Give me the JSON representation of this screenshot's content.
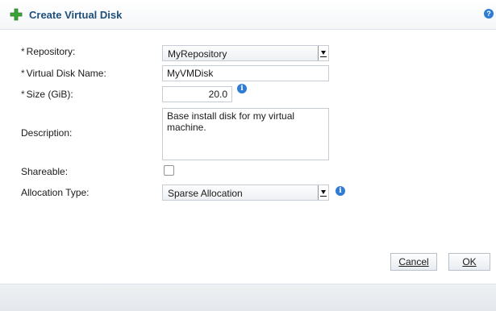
{
  "dialog": {
    "title": "Create Virtual Disk",
    "help_icon": "question-icon",
    "title_icon": "plus-icon"
  },
  "form": {
    "repository": {
      "required_mark": "*",
      "label": "Repository:",
      "value": "MyRepository"
    },
    "disk_name": {
      "required_mark": "*",
      "label": "Virtual Disk Name:",
      "value": "MyVMDisk"
    },
    "size": {
      "required_mark": "*",
      "label": "Size (GiB):",
      "value": "20.0"
    },
    "description": {
      "label": "Description:",
      "value": "Base install disk for my virtual machine."
    },
    "shareable": {
      "label": "Shareable:",
      "checked": false
    },
    "allocation_type": {
      "label": "Allocation Type:",
      "value": "Sparse Allocation"
    }
  },
  "buttons": {
    "cancel": "Cancel",
    "ok": "OK"
  },
  "colors": {
    "title_text": "#1f4f7a",
    "info_icon": "#2f7bd6",
    "plus_icon": "#3aa536"
  }
}
